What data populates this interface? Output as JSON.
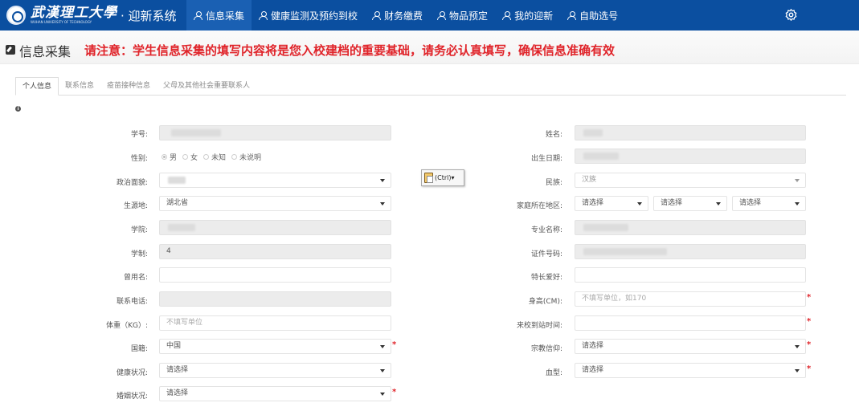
{
  "header": {
    "logo_text": "武漢理工大學",
    "logo_subtext": "WUHAN UNIVERSITY OF TECHNOLOGY",
    "system_name": "· 迎新系统",
    "nav": [
      {
        "label": "信息采集",
        "active": true
      },
      {
        "label": "健康监测及预约到校",
        "active": false
      },
      {
        "label": "财务缴费",
        "active": false
      },
      {
        "label": "物品预定",
        "active": false
      },
      {
        "label": "我的迎新",
        "active": false
      },
      {
        "label": "自助选号",
        "active": false
      }
    ],
    "settings_icon": "gear-icon",
    "active_color": "#1a60b3",
    "bar_color": "#0b4fa0"
  },
  "page": {
    "title": "信息采集",
    "notice": "请注意：学生信息采集的填写内容将是您入校建档的重要基础，请务必认真填写，确保信息准确有效",
    "notice_color": "#e0242a"
  },
  "tabs": [
    "个人信息",
    "联系信息",
    "疫苗接种信息",
    "父母及其他社会重要联系人"
  ],
  "form": {
    "student_id": {
      "label": "学号:"
    },
    "gender": {
      "label": "性别:",
      "options": [
        "男",
        "女",
        "未知",
        "未说明"
      ],
      "selected": "男"
    },
    "political_status": {
      "label": "政治面貌:"
    },
    "origin": {
      "label": "生源地:",
      "value": "湖北省"
    },
    "college": {
      "label": "学院:"
    },
    "duration": {
      "label": "学制:",
      "value": "4"
    },
    "former_name": {
      "label": "曾用名:"
    },
    "phone": {
      "label": "联系电话:"
    },
    "weight": {
      "label": "体重（KG）:",
      "placeholder": "不填写单位"
    },
    "nationality": {
      "label": "国籍:",
      "value": "中国"
    },
    "health": {
      "label": "健康状况:",
      "value": "请选择"
    },
    "marital": {
      "label": "婚姻状况:",
      "value": "请选择"
    },
    "name": {
      "label": "姓名:"
    },
    "birthdate": {
      "label": "出生日期:"
    },
    "ethnicity": {
      "label": "民族:",
      "value": "汉族"
    },
    "home_region": {
      "label": "家庭所在地区:",
      "province": "请选择",
      "city": "请选择",
      "district": "请选择"
    },
    "major": {
      "label": "专业名称:"
    },
    "id_number": {
      "label": "证件号码:"
    },
    "hobbies": {
      "label": "特长爱好:"
    },
    "height": {
      "label": "身高(CM):",
      "placeholder": "不填写单位，如170"
    },
    "arrival_time": {
      "label": "来校到站时间:"
    },
    "religion": {
      "label": "宗教信仰:",
      "value": "请选择"
    },
    "blood_type": {
      "label": "血型:",
      "value": "请选择"
    }
  },
  "paste_popup": {
    "label": "(Ctrl)▾"
  }
}
